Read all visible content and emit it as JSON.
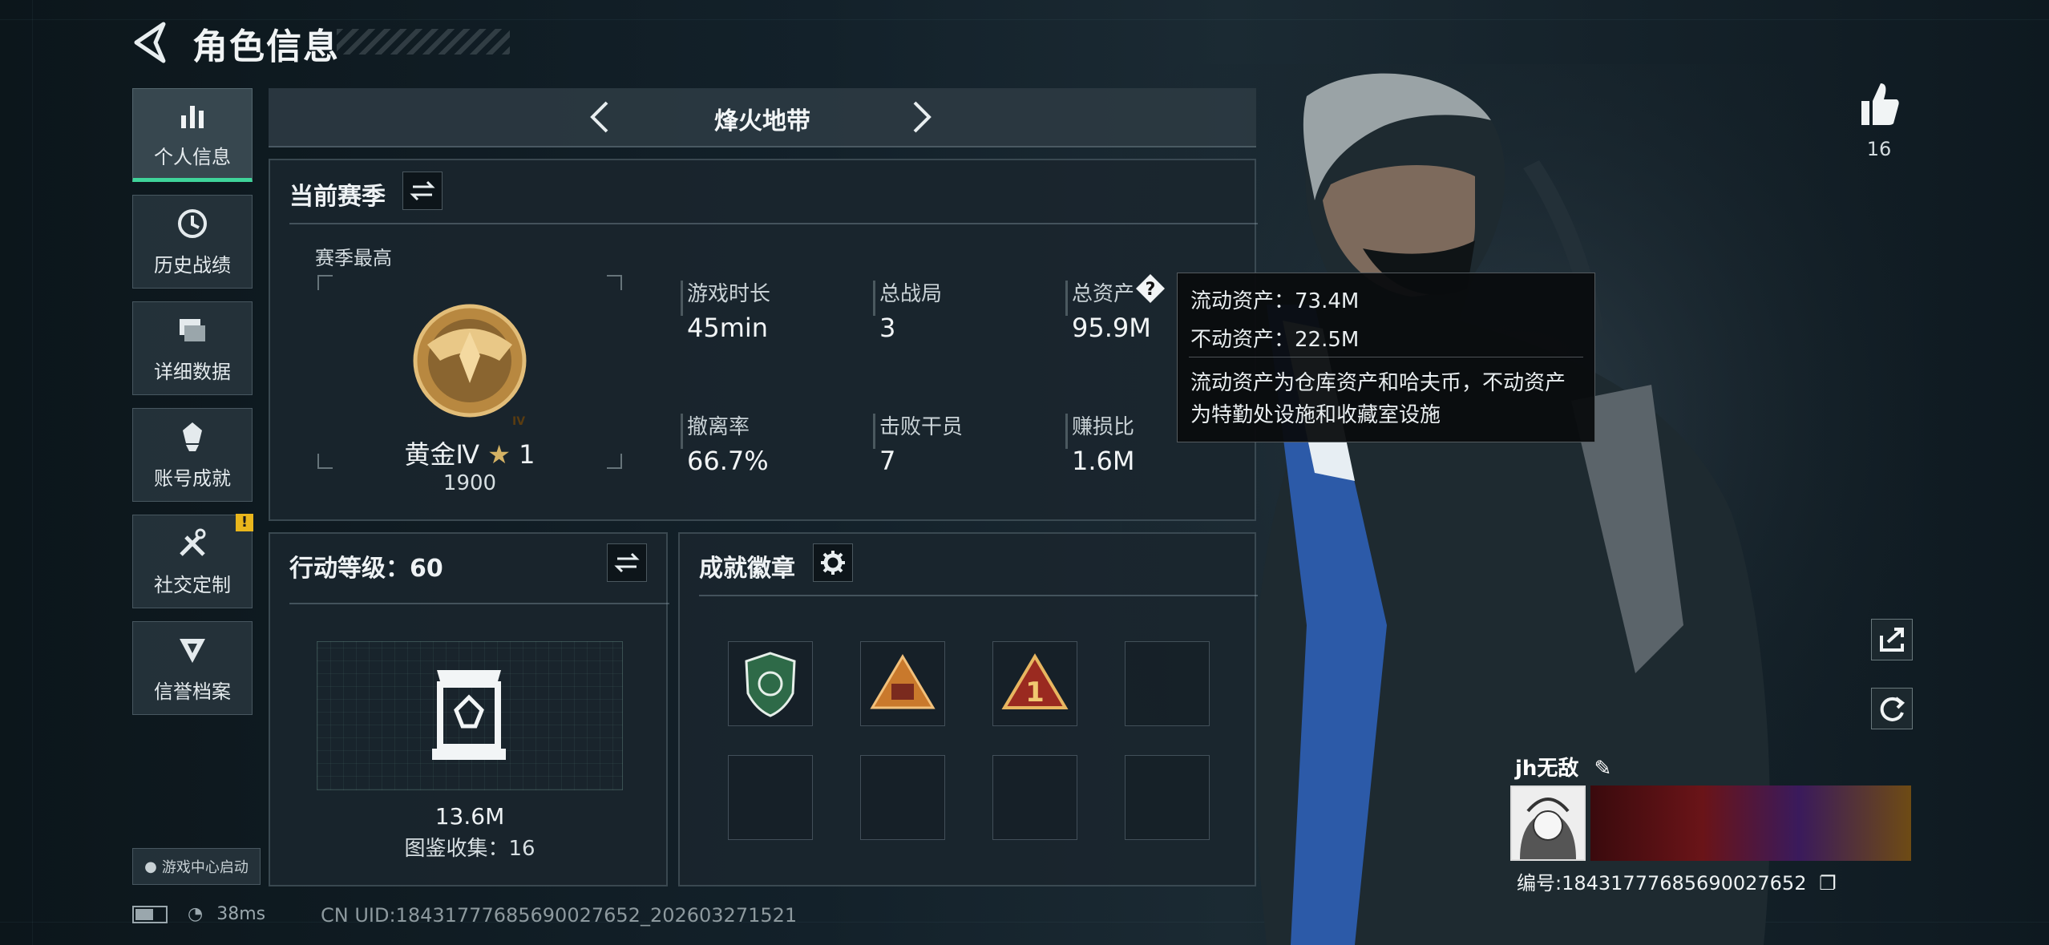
{
  "header": {
    "title": "角色信息"
  },
  "sidebar": {
    "items": [
      {
        "label": "个人信息",
        "icon": "bar-chart-icon",
        "active": true
      },
      {
        "label": "历史战绩",
        "icon": "clock-icon"
      },
      {
        "label": "详细数据",
        "icon": "folders-icon"
      },
      {
        "label": "账号成就",
        "icon": "achievement-icon"
      },
      {
        "label": "社交定制",
        "icon": "tools-icon",
        "badge": "!"
      },
      {
        "label": "信誉档案",
        "icon": "credit-icon"
      }
    ],
    "launcher": "游戏中心启动"
  },
  "mode": {
    "name": "烽火地带"
  },
  "season": {
    "title": "当前赛季",
    "subtitle": "赛季最高",
    "rank_name": "黄金Ⅳ",
    "rank_stars": "1",
    "rank_score": "1900",
    "medal_numeral": "IV",
    "stats": [
      {
        "label": "游戏时长",
        "value": "45min"
      },
      {
        "label": "总战局",
        "value": "3"
      },
      {
        "label": "总资产",
        "value": "95.9M"
      },
      {
        "label": "撤离率",
        "value": "66.7%"
      },
      {
        "label": "击败干员",
        "value": "7"
      },
      {
        "label": "赚损比",
        "value": "1.6M"
      }
    ]
  },
  "tooltip": {
    "liquid": "流动资产：73.4M",
    "fixed": "不动资产：22.5M",
    "desc_line1": "流动资产为仓库资产和哈夫币，不动资产",
    "desc_line2": "为特勤处设施和收藏室设施"
  },
  "action_level": {
    "title": "行动等级：60",
    "value": "13.6M",
    "collection": "图鉴收集：16"
  },
  "achievements": {
    "title": "成就徽章",
    "badges": [
      "green-shield-badge",
      "orange-triangle-badge",
      "number-one-triangle-badge",
      "",
      "",
      "",
      "",
      ""
    ]
  },
  "profile": {
    "likes": "16",
    "name": "jh无敌",
    "id": "编号:18431777685690027652"
  },
  "status": {
    "ping": "38ms",
    "uid": "CN UID:18431777685690027652_202603271521"
  },
  "colors": {
    "accent": "#3fd49a",
    "gold": "#c89a4a",
    "warning": "#e9b61c"
  }
}
